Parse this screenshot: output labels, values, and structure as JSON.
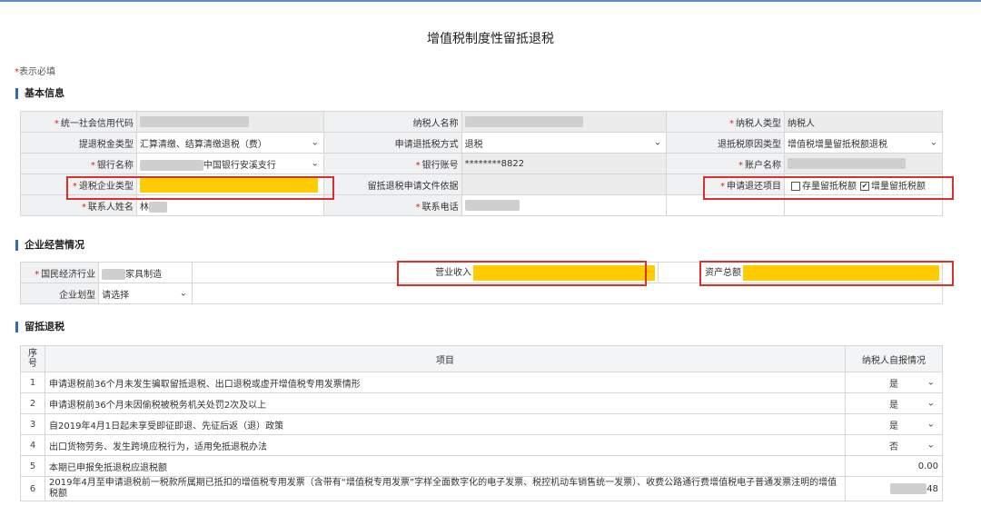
{
  "title": "增值税制度性留抵退税",
  "required_note": {
    "star": "*",
    "text": "表示必填"
  },
  "sections": {
    "basic": "基本信息",
    "business": "企业经营情况",
    "refund": "留抵退税"
  },
  "basic": {
    "credit_code_label": "统一社会信用代码",
    "taxpayer_name_label": "纳税人名称",
    "taxpayer_type_label": "纳税人类型",
    "taxpayer_type_value": "纳税人",
    "refund_type_label": "提退税金类型",
    "refund_type_value": "汇算清缴、结算清缴退税（费）",
    "refund_method_label": "申请退抵税方式",
    "refund_method_value": "退税",
    "refund_reason_label": "退抵税原因类型",
    "refund_reason_value": "增值税增量留抵税额退税",
    "bank_name_label": "银行名称",
    "bank_name_value": "中国银行安溪支行",
    "bank_account_label": "银行账号",
    "bank_account_value": "********8822",
    "account_name_label": "账户名称",
    "company_type_label": "退税企业类型",
    "doc_basis_label": "留抵退税申请文件依据",
    "return_item_label": "申请退还项目",
    "stock_option": "存量留抵税额",
    "incremental_option": "增量留抵税额",
    "contact_name_label": "联系人姓名",
    "contact_name_value": "林",
    "contact_phone_label": "联系电话"
  },
  "business": {
    "industry_label": "国民经济行业",
    "industry_value": "家具制造",
    "revenue_label": "营业收入",
    "assets_label": "资产总额",
    "scale_label": "企业划型",
    "scale_value": "请选择"
  },
  "refund_table": {
    "headers": {
      "no": "序号",
      "item": "项目",
      "self": "纳税人自报情况"
    },
    "rows": [
      {
        "no": "1",
        "item": "申请退税前36个月未发生骗取留抵退税、出口退税或虚开增值税专用发票情形",
        "value": "是"
      },
      {
        "no": "2",
        "item": "申请退税前36个月未因偷税被税务机关处罚2次及以上",
        "value": "是"
      },
      {
        "no": "3",
        "item": "自2019年4月1日起未享受即征即退、先征后返（退）政策",
        "value": "是"
      },
      {
        "no": "4",
        "item": "出口货物劳务、发生跨境应税行为，适用免抵退税办法",
        "value": "否"
      },
      {
        "no": "5",
        "item": "本期已申报免抵退税应退税额",
        "value": "0.00"
      },
      {
        "no": "6",
        "item": "2019年4月至申请退税前一税款所属期已抵扣的增值税专用发票（含带有“增值税专用发票”字样全面数字化的电子发票、税控机动车销售统一发票）、收费公路通行费增值税电子普通发票注明的增值税额",
        "value": "48"
      }
    ]
  },
  "colors": {
    "highlight": "#ffcc00",
    "annotation": "#d9302c",
    "section_bar": "#2e6db4"
  },
  "icons": {
    "dropdown": "chevron-down-icon",
    "checkbox": "checkbox-icon"
  }
}
